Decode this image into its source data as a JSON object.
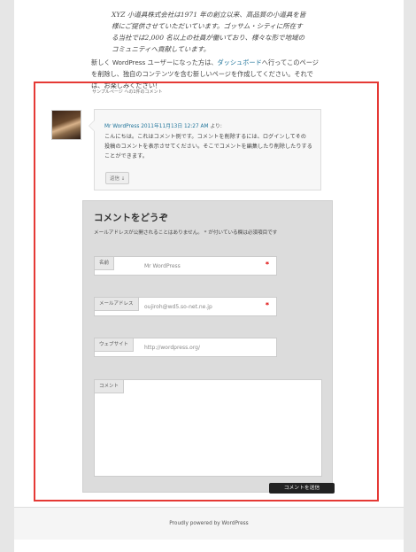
{
  "post": {
    "quote": "XYZ 小道具株式会社は1971 年の創立以来、高品質の小道具を皆様にご提供させていただいています。ゴッサム・シティに所在する当社では2,000 名以上の社員が働いており、様々な形で地域のコミュニティへ貢献しています。",
    "intro_before_link": "新しく WordPress ユーザーになった方は、",
    "intro_link": "ダッシュボード",
    "intro_after_link": "へ行ってこのページを削除し、独自のコンテンツを含む新しいページを作成してください。それでは、お楽しみください！"
  },
  "comments": {
    "title": "サンプルページ への1件のコメント",
    "items": [
      {
        "author": "Mr WordPress",
        "date": "2011年11月13日 12:27 AM",
        "says": "より:",
        "body": "こんにちは。これはコメント例です。コメントを削除するには、ログインしてその 投稿のコメントを表示させてください。そこでコメントを編集したり削除したりすることができます。",
        "reply_label": "返信 ↓"
      }
    ]
  },
  "form": {
    "title": "コメントをどうぞ",
    "note": "メールアドレスが公開されることはありません。 * が付いている欄は必須項目です",
    "fields": [
      {
        "label": "名前",
        "value": "Mr WordPress",
        "required": "*"
      },
      {
        "label": "メールアドレス",
        "value": "oujiroh@wd5.so-net.ne.jp",
        "required": "*"
      },
      {
        "label": "ウェブサイト",
        "value": "http://wordpress.org/"
      },
      {
        "label": "コメント",
        "value": ""
      }
    ],
    "submit_label": "コメントを送信"
  },
  "footer": {
    "text": "Proudly powered by WordPress"
  },
  "colors": {
    "highlight_border": "#e53935",
    "link": "#21759b",
    "required": "#d00000"
  }
}
